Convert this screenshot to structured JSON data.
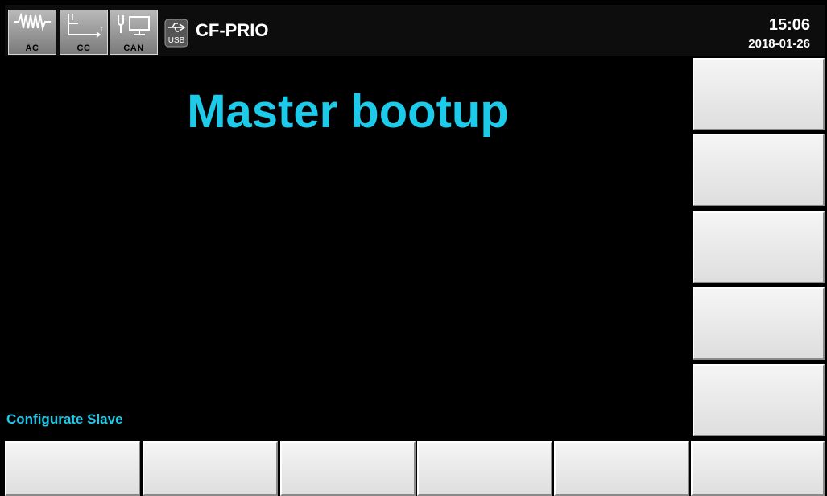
{
  "status_bar": {
    "modes": [
      {
        "label": "AC",
        "icon": "ac-waveform-icon"
      },
      {
        "label": "CC",
        "icon": "cc-graph-icon"
      },
      {
        "label": "CAN",
        "icon": "can-network-icon"
      }
    ],
    "usb_label": "USB",
    "title": "CF-PRIO",
    "time": "15:06",
    "date": "2018-01-26"
  },
  "main": {
    "title": "Master bootup",
    "status_message": "Configurate Slave"
  },
  "softkeys": {
    "side": [
      "",
      "",
      "",
      "",
      ""
    ],
    "bottom": [
      "",
      "",
      "",
      "",
      "",
      ""
    ]
  },
  "colors": {
    "accent": "#1ccaea",
    "background": "#000000",
    "softkey": "#e8e8e8"
  }
}
